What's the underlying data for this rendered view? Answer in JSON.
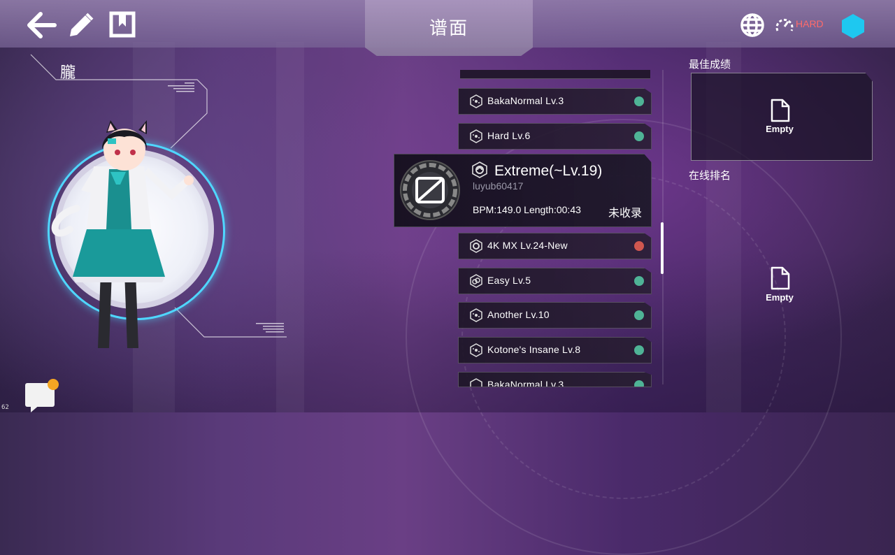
{
  "header": {
    "title": "谱面",
    "difficulty_label": "HARD"
  },
  "character": {
    "name": "朧"
  },
  "chart_list": {
    "items_above": [
      {
        "label": "BakaNormal  Lv.3",
        "status_color": "#4fb396"
      },
      {
        "label": "Hard  Lv.6",
        "status_color": "#4fb396"
      }
    ],
    "selected": {
      "title": "Extreme(~Lv.19)",
      "author": "luyub60417",
      "stats": "BPM:149.0  Length:00:43",
      "collect_status": "未收录"
    },
    "items_below": [
      {
        "label": "4K MX Lv.24-New",
        "status_color": "#d0574f"
      },
      {
        "label": "Easy Lv.5",
        "status_color": "#4fb396"
      },
      {
        "label": "Another  Lv.10",
        "status_color": "#4fb396"
      },
      {
        "label": "Kotone's Insane  Lv.8",
        "status_color": "#4fb396"
      },
      {
        "label": "BakaNormal  Lv.3",
        "status_color": "#4fb396"
      }
    ]
  },
  "best_score": {
    "title": "最佳成绩",
    "empty_label": "Empty"
  },
  "online_rank": {
    "title": "在线排名",
    "empty_label": "Empty"
  },
  "fps": "62",
  "colors": {
    "accent_cyan": "#1ec8f0",
    "hard_red": "#ff6a6a",
    "status_green": "#4fb396",
    "status_red": "#d0574f",
    "notification": "#f5a623"
  }
}
